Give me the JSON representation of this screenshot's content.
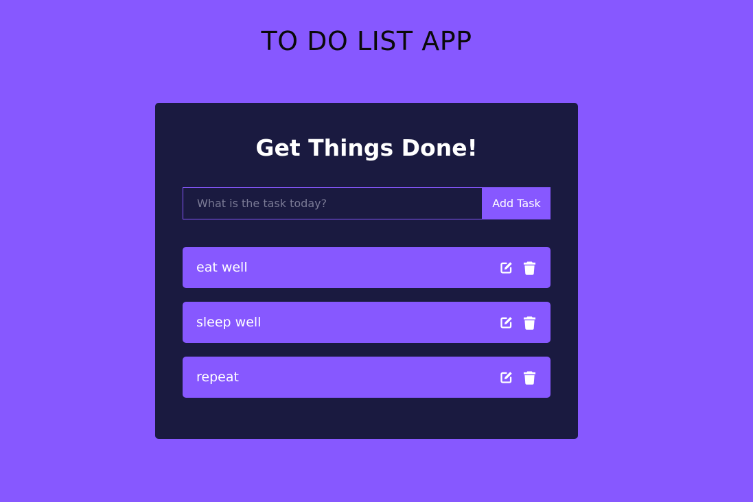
{
  "app_title": "TO DO LIST APP",
  "card": {
    "heading": "Get Things Done!"
  },
  "form": {
    "placeholder": "What is the task today?",
    "value": "",
    "add_label": "Add Task"
  },
  "tasks": [
    {
      "text": "eat well",
      "icons": [
        "edit-icon",
        "trash-icon"
      ]
    },
    {
      "text": "sleep well",
      "icons": [
        "edit-icon",
        "trash-icon"
      ]
    },
    {
      "text": "repeat",
      "icons": [
        "edit-icon",
        "trash-icon"
      ]
    }
  ],
  "colors": {
    "background": "#8758ff",
    "card": "#1a1a40",
    "task_item": "#8758ff",
    "text_light": "#ffffff",
    "title_text": "#0a0a0a"
  }
}
